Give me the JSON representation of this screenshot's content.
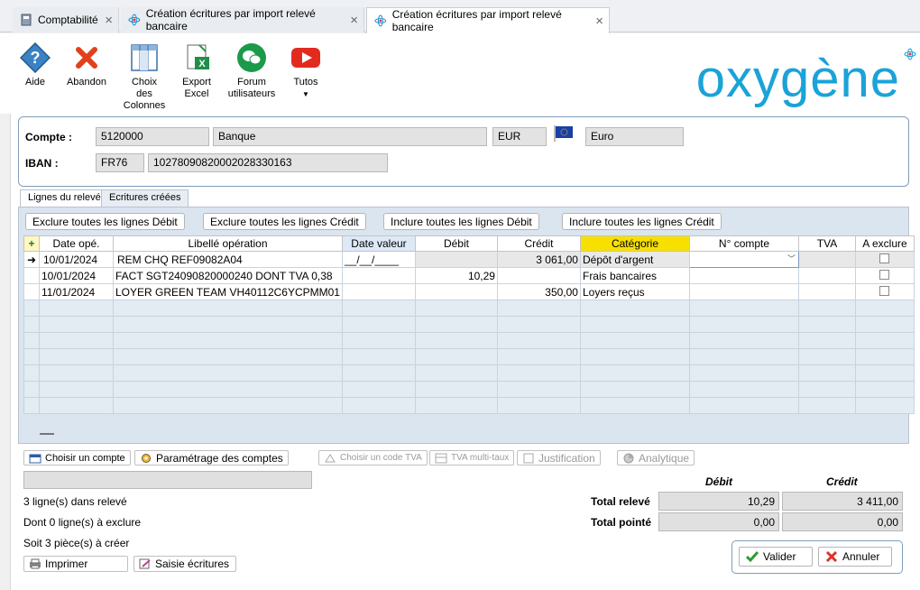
{
  "tabs": [
    {
      "label": "Comptabilité",
      "active": false
    },
    {
      "label": "Création écritures par import relevé bancaire",
      "active": false
    },
    {
      "label": "Création écritures par import relevé bancaire",
      "active": true
    }
  ],
  "toolbar": {
    "aide": "Aide",
    "abandon": "Abandon",
    "choix_colonnes": [
      "Choix",
      "des",
      "Colonnes"
    ],
    "export_excel": [
      "Export",
      "Excel"
    ],
    "forum": [
      "Forum",
      "utilisateurs"
    ],
    "tutos": "Tutos"
  },
  "logo": "oxygène",
  "account": {
    "compte_label": "Compte :",
    "compte_num": "5120000",
    "compte_name": "Banque",
    "currency_code": "EUR",
    "currency_name": "Euro",
    "iban_label": "IBAN :",
    "iban_prefix": "FR76",
    "iban_rest": "10278090820002028330163"
  },
  "subtabs": [
    "Lignes du relevé",
    "Ecritures créées"
  ],
  "actions": [
    "Exclure toutes les lignes Débit",
    "Exclure toutes les lignes Crédit",
    "Inclure toutes les lignes Débit",
    "Inclure toutes les lignes Crédit"
  ],
  "columns": [
    "",
    "Date opé.",
    "Libellé opération",
    "Date valeur",
    "Débit",
    "Crédit",
    "Catégorie",
    "N° compte",
    "TVA",
    "A exclure"
  ],
  "rows": [
    {
      "marker": "➜",
      "date": "10/01/2024",
      "libelle": "REM CHQ REF09082A04",
      "date_valeur": "__/__/____",
      "debit": "",
      "credit": "3 061,00",
      "categorie": "Dépôt d'argent",
      "compte": "",
      "tva": ""
    },
    {
      "marker": "",
      "date": "10/01/2024",
      "libelle": "FACT SGT24090820000240 DONT TVA 0,38",
      "date_valeur": "",
      "debit": "10,29",
      "credit": "",
      "categorie": "Frais bancaires",
      "compte": "",
      "tva": ""
    },
    {
      "marker": "",
      "date": "11/01/2024",
      "libelle": "LOYER GREEN TEAM VH40112C6YCPMM01",
      "date_valeur": "",
      "debit": "",
      "credit": "350,00",
      "categorie": "Loyers reçus",
      "compte": "",
      "tva": ""
    }
  ],
  "bottom_buttons": {
    "choisir_compte": "Choisir un compte",
    "parametrage": "Paramétrage des comptes",
    "choisir_tva": "Choisir un code TVA",
    "tva_multi": "TVA multi-taux",
    "justification": "Justification",
    "analytique": "Analytique"
  },
  "status": {
    "lignes": "3 ligne(s) dans relevé",
    "exclure": "Dont 0 ligne(s) à exclure",
    "pieces": "Soit 3 pièce(s) à créer"
  },
  "totals": {
    "debit_header": "Débit",
    "credit_header": "Crédit",
    "releve_label": "Total relevé",
    "releve_debit": "10,29",
    "releve_credit": "3 411,00",
    "pointe_label": "Total pointé",
    "pointe_debit": "0,00",
    "pointe_credit": "0,00"
  },
  "footer": {
    "imprimer": "Imprimer",
    "saisie": "Saisie écritures",
    "valider": "Valider",
    "annuler": "Annuler"
  }
}
